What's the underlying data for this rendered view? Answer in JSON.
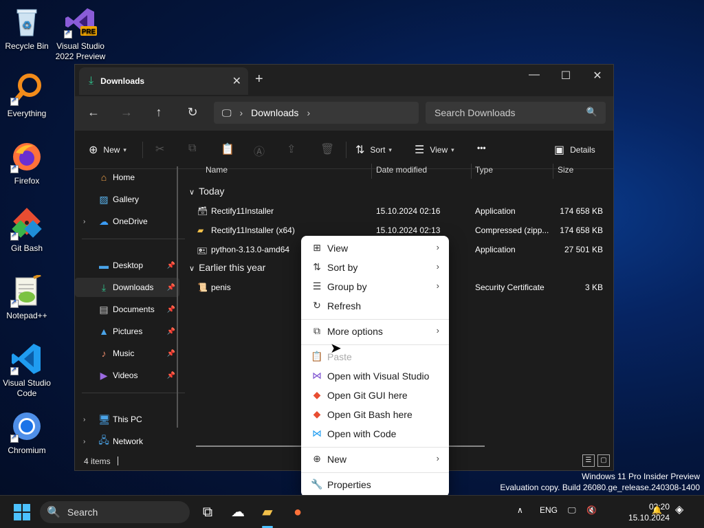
{
  "desktop": {
    "icons": [
      {
        "label": "Recycle Bin"
      },
      {
        "label": "Visual Studio 2022 Preview",
        "badge": "PRE"
      },
      {
        "label": "Everything"
      },
      {
        "label": "Firefox"
      },
      {
        "label": "Git Bash"
      },
      {
        "label": "Notepad++"
      },
      {
        "label": "Visual Studio Code"
      },
      {
        "label": "Chromium"
      }
    ],
    "watermark": {
      "line1": "Windows 11 Pro Insider Preview",
      "line2": "Evaluation copy. Build 26080.ge_release.240308-1400"
    }
  },
  "explorer": {
    "tab_title": "Downloads",
    "breadcrumb": "Downloads",
    "search_placeholder": "Search Downloads",
    "toolbar": {
      "new_label": "New",
      "sort_label": "Sort",
      "view_label": "View",
      "more_label": "•••",
      "details_label": "Details"
    },
    "sidebar": {
      "items": [
        {
          "label": "Home",
          "icon": "home-icon"
        },
        {
          "label": "Gallery",
          "icon": "gallery-icon"
        },
        {
          "label": "OneDrive",
          "icon": "cloud-icon"
        },
        {
          "label": "Desktop",
          "icon": "desktop-icon",
          "pinned": true
        },
        {
          "label": "Downloads",
          "icon": "download-icon",
          "pinned": true,
          "selected": true
        },
        {
          "label": "Documents",
          "icon": "document-icon",
          "pinned": true
        },
        {
          "label": "Pictures",
          "icon": "picture-icon",
          "pinned": true
        },
        {
          "label": "Music",
          "icon": "music-icon",
          "pinned": true
        },
        {
          "label": "Videos",
          "icon": "video-icon",
          "pinned": true
        },
        {
          "label": "This PC",
          "icon": "pc-icon"
        },
        {
          "label": "Network",
          "icon": "network-icon"
        }
      ]
    },
    "columns": {
      "name": "Name",
      "date": "Date modified",
      "type": "Type",
      "size": "Size"
    },
    "groups": [
      {
        "title": "Today",
        "files": [
          {
            "name": "Rectify11Installer",
            "date": "15.10.2024 02:16",
            "type": "Application",
            "size": "174 658 KB"
          },
          {
            "name": "Rectify11Installer (x64)",
            "date": "15.10.2024 02:13",
            "type": "Compressed (zipp...",
            "size": "174 658 KB"
          },
          {
            "name": "python-3.13.0-amd64",
            "date": "",
            "type": "Application",
            "size": "27 501 KB"
          }
        ]
      },
      {
        "title": "Earlier this year",
        "files": [
          {
            "name": "penis",
            "date": "",
            "type": "Security Certificate",
            "size": "3 KB"
          }
        ]
      }
    ],
    "status": "4 items"
  },
  "context_menu": {
    "items": [
      {
        "label": "View",
        "icon": "view-grid-icon",
        "submenu": true
      },
      {
        "label": "Sort by",
        "icon": "sort-icon",
        "submenu": true
      },
      {
        "label": "Group by",
        "icon": "group-icon",
        "submenu": true
      },
      {
        "label": "Refresh",
        "icon": "refresh-icon"
      },
      {
        "label": "More options",
        "icon": "more-options-icon",
        "submenu": true
      },
      {
        "label": "Paste",
        "icon": "paste-icon",
        "disabled": true
      },
      {
        "label": "Open with Visual Studio",
        "icon": "visual-studio-icon"
      },
      {
        "label": "Open Git GUI here",
        "icon": "git-icon"
      },
      {
        "label": "Open Git Bash here",
        "icon": "git-icon"
      },
      {
        "label": "Open with Code",
        "icon": "vscode-icon"
      },
      {
        "label": "New",
        "icon": "new-icon",
        "submenu": true
      },
      {
        "label": "Properties",
        "icon": "properties-icon"
      }
    ]
  },
  "taskbar": {
    "search_label": "Search",
    "language": "ENG",
    "time": "02:20",
    "date": "15.10.2024"
  },
  "colors": {
    "accent": "#4cc2ff",
    "explorer_bg": "#1c1c1c",
    "menu_bg": "#ffffff"
  }
}
